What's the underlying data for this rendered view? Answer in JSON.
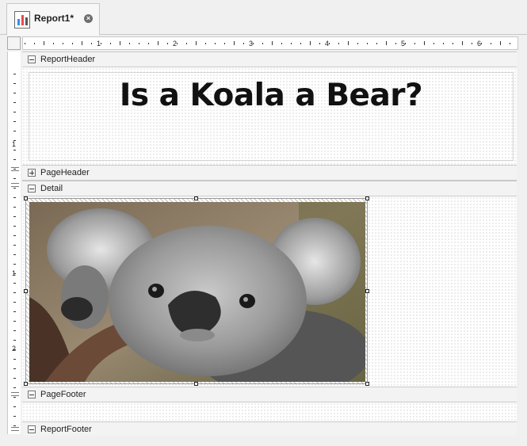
{
  "document_tab": {
    "title": "Report1*",
    "icon": "report-chart-icon",
    "close_icon": "close-icon"
  },
  "ruler": {
    "horizontal_numbers": [
      "1",
      "2",
      "3",
      "4",
      "5",
      "6"
    ],
    "vertical_numbers": [
      "1",
      "1",
      "2"
    ]
  },
  "bands": {
    "report_header": {
      "label": "ReportHeader",
      "expanded": true
    },
    "page_header": {
      "label": "PageHeader",
      "expanded": false
    },
    "detail": {
      "label": "Detail",
      "expanded": true
    },
    "page_footer": {
      "label": "PageFooter",
      "expanded": true
    },
    "report_footer": {
      "label": "ReportFooter",
      "expanded": true
    }
  },
  "report_title": {
    "text": "Is a Koala a Bear?"
  },
  "picture_control": {
    "content": "koala-photo",
    "selected": true
  },
  "colors": {
    "surface": "#ffffff",
    "band_header": "#f3f3f3",
    "grid_dot": "#b4b4b4",
    "selection_handle": "#222222"
  }
}
